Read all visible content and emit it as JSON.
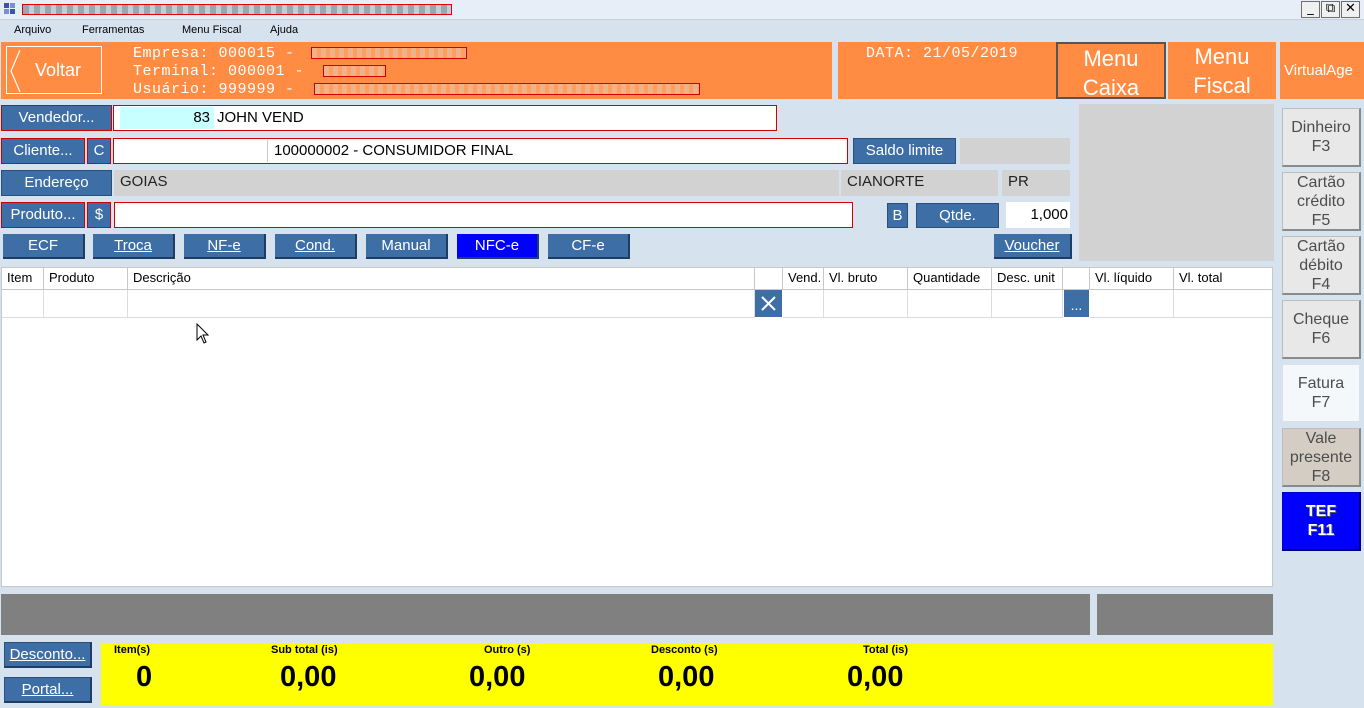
{
  "menu": {
    "arquivo": "Arquivo",
    "ferramentas": "Ferramentas",
    "menu_fiscal": "Menu Fiscal",
    "ajuda": "Ajuda"
  },
  "header": {
    "voltar": "Voltar",
    "empresa": "Empresa: 000015 -",
    "terminal": "Terminal: 000001 -",
    "usuario": "Usuário: 999999 -",
    "data": "DATA: 21/05/2019",
    "menu_caixa": [
      "Menu",
      "Caixa"
    ],
    "menu_fiscal": [
      "Menu",
      "Fiscal"
    ],
    "virtualage": "VirtualAge"
  },
  "form": {
    "vendedor_btn": "Vendedor...",
    "vendedor_code": "83",
    "vendedor_name": "JOHN VEND",
    "cliente_btn": "Cliente...",
    "cliente_c": "C",
    "cliente_code_value": "",
    "cliente_name": "100000002 - CONSUMIDOR FINAL",
    "saldo_limite": "Saldo limite",
    "endereco_btn": "Endereço",
    "endereco_uf_name": "GOIAS",
    "cidade": "CIANORTE",
    "uf": "PR",
    "produto_btn": "Produto...",
    "produto_dollar": "$",
    "produto_value": "",
    "b_btn": "B",
    "qtde_btn": "Qtde.",
    "qtde_value": "1,000"
  },
  "tabs": [
    {
      "label": "ECF",
      "active": false
    },
    {
      "label": "Troca",
      "active": false
    },
    {
      "label": "NF-e",
      "active": false
    },
    {
      "label": "Cond.",
      "active": false
    },
    {
      "label": "Manual",
      "active": false
    },
    {
      "label": "NFC-e",
      "active": true
    },
    {
      "label": "CF-e",
      "active": false
    }
  ],
  "voucher": "Voucher",
  "grid": {
    "columns": [
      "Item",
      "Produto",
      "Descrição",
      "",
      "Vend.",
      "Vl. bruto",
      "Quantidade",
      "Desc. unit",
      "",
      "Vl. líquido",
      "Vl. total"
    ],
    "ellipsis": "..."
  },
  "side_buttons": [
    {
      "lines": [
        "Dinheiro",
        "F3"
      ],
      "style": "normal"
    },
    {
      "lines": [
        "Cartão",
        "crédito",
        "F5"
      ],
      "style": "normal"
    },
    {
      "lines": [
        "Cartão",
        "débito",
        "F4"
      ],
      "style": "normal"
    },
    {
      "lines": [
        "Cheque",
        "F6"
      ],
      "style": "normal"
    },
    {
      "lines": [
        "Fatura",
        "F7"
      ],
      "style": "light"
    },
    {
      "lines": [
        "Vale",
        "presente",
        "F8"
      ],
      "style": "tan"
    },
    {
      "lines": [
        "TEF",
        "F11"
      ],
      "style": "blue"
    }
  ],
  "footer": {
    "desconto_btn": "Desconto...",
    "portal_btn": "Portal...",
    "itens_label": "Item(s)",
    "itens_value": "0",
    "subtotal_label": "Sub total (is)",
    "subtotal_value": "0,00",
    "outro_label": "Outro (s)",
    "outro_value": "0,00",
    "desconto_label": "Desconto (s)",
    "desconto_value": "0,00",
    "total_label": "Total (is)",
    "total_value": "0,00"
  },
  "colors": {
    "header_orange": "#ff8c42",
    "button_blue": "#3d6fa6",
    "active_tab_blue": "#0000ff",
    "tef_blue": "#0000ff",
    "totals_yellow": "#ffff00"
  }
}
